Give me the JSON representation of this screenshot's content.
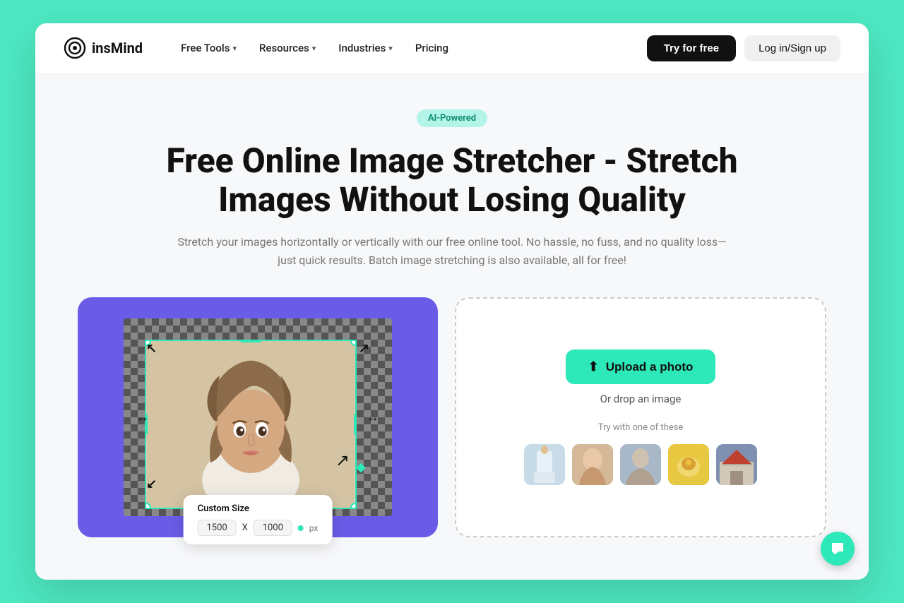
{
  "meta": {
    "bg_color": "#4de8c2",
    "window_bg": "white"
  },
  "nav": {
    "logo_text": "insMind",
    "links": [
      {
        "id": "free-tools",
        "label": "Free Tools",
        "has_dropdown": true
      },
      {
        "id": "resources",
        "label": "Resources",
        "has_dropdown": true
      },
      {
        "id": "industries",
        "label": "Industries",
        "has_dropdown": true
      },
      {
        "id": "pricing",
        "label": "Pricing",
        "has_dropdown": false
      }
    ],
    "try_label": "Try for free",
    "login_label": "Log in/Sign up"
  },
  "hero": {
    "badge": "AI-Powered",
    "title": "Free Online Image Stretcher - Stretch Images Without Losing Quality",
    "subtitle": "Stretch your images horizontally or vertically with our free online tool. No hassle, no fuss, and no quality loss—just quick results. Batch image stretching is also available, all for free!"
  },
  "tool": {
    "custom_size_label": "Custom Size",
    "width_value": "1500",
    "x_label": "X",
    "height_value": "1000",
    "unit_label": "px"
  },
  "upload": {
    "button_label": "Upload a photo",
    "drop_label": "Or drop an image",
    "sample_label": "Try with one of these"
  },
  "chat_icon": "💬"
}
